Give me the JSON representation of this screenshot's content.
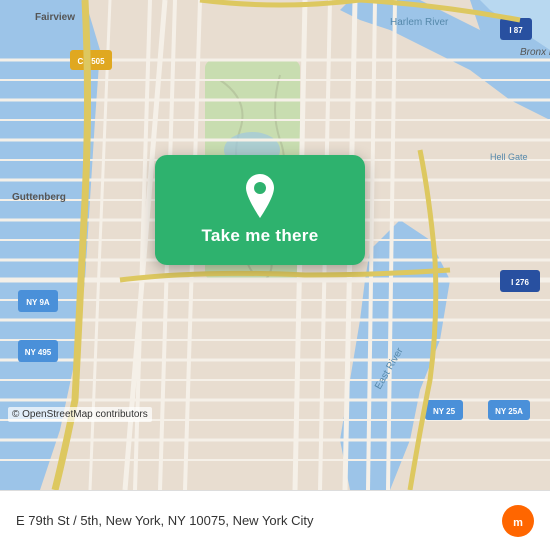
{
  "map": {
    "alt": "Map of E 79th St / 5th, New York, NY 10075",
    "attribution": "© OpenStreetMap contributors"
  },
  "card": {
    "button_label": "Take me there",
    "pin_icon": "location-pin-icon"
  },
  "bottom_bar": {
    "location_text": "E 79th St / 5th, New York, NY 10075, New York City",
    "logo_alt": "moovit"
  }
}
